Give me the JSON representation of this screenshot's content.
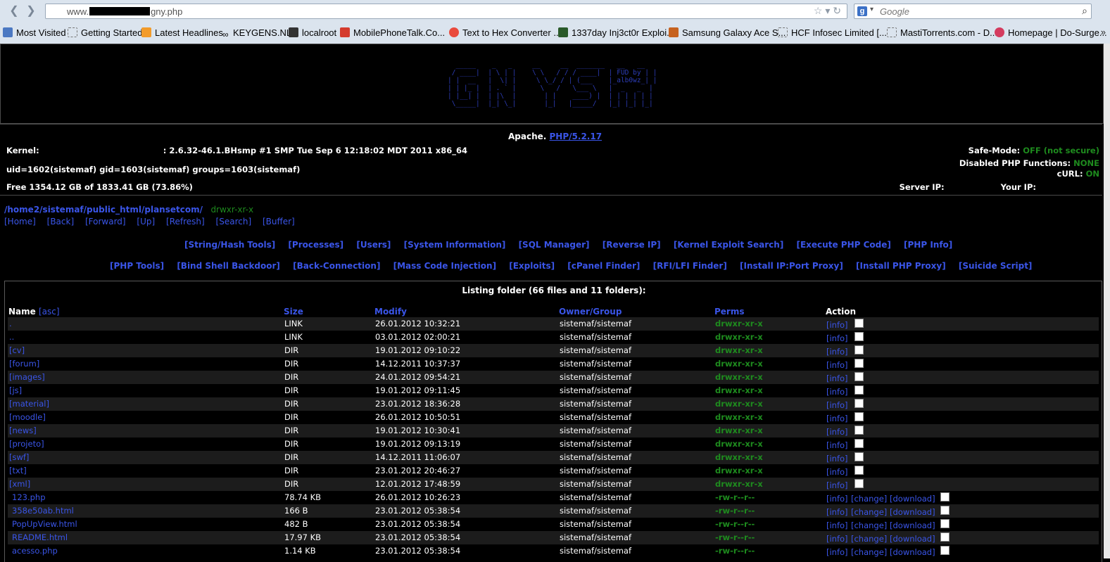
{
  "browser": {
    "url_prefix": "www.",
    "url_suffix": "gny.php",
    "search_placeholder": "Google",
    "bookmarks": [
      "Most Visited",
      "Getting Started",
      "Latest Headlines",
      "KEYGENS.NL",
      "localroot",
      "MobilePhoneTalk.Co...",
      "Text to Hex Converter ...",
      "1337day Inj3ct0r Exploi...",
      "Samsung Galaxy Ace S...",
      "HCF Infosec Limited [...",
      "MastiTorrents.com - D...",
      "Homepage | Do-Surge..."
    ]
  },
  "banner": {
    "ascii_art": "  _____    _   _     __     __  _______   __   __\n / ____|  | \\ | |    \\ \\   / / / ____|  | FUD by | |\n| |  __   |  \\| |     \\ \\_/ / | (___    |_alb0wz_| |\n| | |_ |  | . ` |      \\   /   \\___ \\   |  _   _  |\n| |__| |  | |\\  |       | |    ____) |  | | | | | |\n \\_____|  |_| \\_|       |_|   |_____/   |_| |_| |_|"
  },
  "info": {
    "server_software": "Apache.",
    "php_version": "PHP/5.2.17",
    "kernel_label": "Kernel:",
    "kernel_value": ": 2.6.32-46.1.BHsmp #1 SMP Tue Sep 6 12:18:02 MDT 2011 x86_64",
    "uid_line": "uid=1602(sistemaf) gid=1603(sistemaf) groups=1603(sistemaf)",
    "free_space": "Free 1354.12 GB of 1833.41 GB (73.86%)",
    "safe_mode_label": "Safe-Mode:",
    "safe_mode_value": "OFF (not secure)",
    "disabled_label": "Disabled PHP Functions:",
    "disabled_value": "NONE",
    "curl_label": "cURL:",
    "curl_value": "ON",
    "server_ip_label": "Server IP:",
    "your_ip_label": "Your IP:"
  },
  "path": {
    "dir": "/home2/sistemaf/public_html/plansetcom/",
    "perms": "drwxr-xr-x"
  },
  "nav_links": [
    "[Home]",
    "[Back]",
    "[Forward]",
    "[Up]",
    "[Refresh]",
    "[Search]",
    "[Buffer]"
  ],
  "menu_row1": [
    "[String/Hash Tools]",
    "[Processes]",
    "[Users]",
    "[System Information]",
    "[SQL Manager]",
    "[Reverse IP]",
    "[Kernel Exploit Search]",
    "[Execute PHP Code]",
    "[PHP Info]"
  ],
  "menu_row2": [
    "[PHP Tools]",
    "[Bind Shell Backdoor]",
    "[Back-Connection]",
    "[Mass Code Injection]",
    "[Exploits]",
    "[cPanel Finder]",
    "[RFI/LFI Finder]",
    "[Install IP:Port Proxy]",
    "[Install PHP Proxy]",
    "[Suicide Script]"
  ],
  "listing": {
    "title": "Listing folder (66 files and 11 folders):",
    "headers": {
      "name": "Name",
      "sort": "[asc]",
      "size": "Size",
      "modify": "Modify",
      "owner": "Owner/Group",
      "perms": "Perms",
      "action": "Action"
    },
    "rows": [
      {
        "name": ".",
        "size": "LINK",
        "modify": "26.01.2012 10:32:21",
        "owner": "sistemaf/sistemaf",
        "perms": "drwxr-xr-x",
        "kind": "dir"
      },
      {
        "name": "..",
        "size": "LINK",
        "modify": "03.01.2012 02:00:21",
        "owner": "sistemaf/sistemaf",
        "perms": "drwxr-xr-x",
        "kind": "dir"
      },
      {
        "name": "[cv]",
        "size": "DIR",
        "modify": "19.01.2012 09:10:22",
        "owner": "sistemaf/sistemaf",
        "perms": "drwxr-xr-x",
        "kind": "dir"
      },
      {
        "name": "[forum]",
        "size": "DIR",
        "modify": "14.12.2011 10:37:37",
        "owner": "sistemaf/sistemaf",
        "perms": "drwxr-xr-x",
        "kind": "dir"
      },
      {
        "name": "[images]",
        "size": "DIR",
        "modify": "24.01.2012 09:54:21",
        "owner": "sistemaf/sistemaf",
        "perms": "drwxr-xr-x",
        "kind": "dir"
      },
      {
        "name": "[js]",
        "size": "DIR",
        "modify": "19.01.2012 09:11:45",
        "owner": "sistemaf/sistemaf",
        "perms": "drwxr-xr-x",
        "kind": "dir"
      },
      {
        "name": "[material]",
        "size": "DIR",
        "modify": "23.01.2012 18:36:28",
        "owner": "sistemaf/sistemaf",
        "perms": "drwxr-xr-x",
        "kind": "dir"
      },
      {
        "name": "[moodle]",
        "size": "DIR",
        "modify": "26.01.2012 10:50:51",
        "owner": "sistemaf/sistemaf",
        "perms": "drwxr-xr-x",
        "kind": "dir"
      },
      {
        "name": "[news]",
        "size": "DIR",
        "modify": "19.01.2012 10:30:41",
        "owner": "sistemaf/sistemaf",
        "perms": "drwxr-xr-x",
        "kind": "dir"
      },
      {
        "name": "[projeto]",
        "size": "DIR",
        "modify": "19.01.2012 09:13:19",
        "owner": "sistemaf/sistemaf",
        "perms": "drwxr-xr-x",
        "kind": "dir"
      },
      {
        "name": "[swf]",
        "size": "DIR",
        "modify": "14.12.2011 11:06:07",
        "owner": "sistemaf/sistemaf",
        "perms": "drwxr-xr-x",
        "kind": "dir"
      },
      {
        "name": "[txt]",
        "size": "DIR",
        "modify": "23.01.2012 20:46:27",
        "owner": "sistemaf/sistemaf",
        "perms": "drwxr-xr-x",
        "kind": "dir"
      },
      {
        "name": "[xml]",
        "size": "DIR",
        "modify": "12.01.2012 17:48:59",
        "owner": "sistemaf/sistemaf",
        "perms": "drwxr-xr-x",
        "kind": "dir"
      },
      {
        "name": "123.php",
        "size": "78.74 KB",
        "modify": "26.01.2012 10:26:23",
        "owner": "sistemaf/sistemaf",
        "perms": "-rw-r--r--",
        "kind": "file"
      },
      {
        "name": "358e50ab.html",
        "size": "166 B",
        "modify": "23.01.2012 05:38:54",
        "owner": "sistemaf/sistemaf",
        "perms": "-rw-r--r--",
        "kind": "file"
      },
      {
        "name": "PopUpView.html",
        "size": "482 B",
        "modify": "23.01.2012 05:38:54",
        "owner": "sistemaf/sistemaf",
        "perms": "-rw-r--r--",
        "kind": "file"
      },
      {
        "name": "README.html",
        "size": "17.97 KB",
        "modify": "23.01.2012 05:38:54",
        "owner": "sistemaf/sistemaf",
        "perms": "-rw-r--r--",
        "kind": "file"
      },
      {
        "name": "acesso.php",
        "size": "1.14 KB",
        "modify": "23.01.2012 05:38:54",
        "owner": "sistemaf/sistemaf",
        "perms": "-rw-r--r--",
        "kind": "file"
      }
    ],
    "actions": {
      "info": "[info]",
      "change": "[change]",
      "download": "[download]"
    }
  },
  "colors": {
    "link": "#3a55e8",
    "green": "#1e8b1e",
    "ascii": "#2d3db8"
  }
}
